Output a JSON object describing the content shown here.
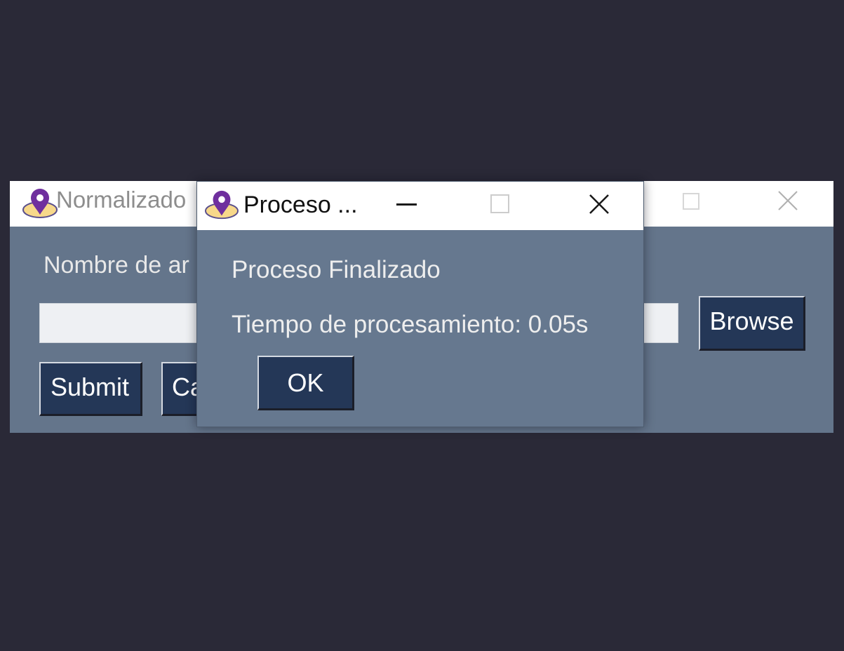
{
  "main_window": {
    "title": "Normalizado",
    "field_label": "Nombre de ar",
    "input_value": "",
    "browse_label": "Browse",
    "submit_label": "Submit",
    "cancel_label": "Ca"
  },
  "dialog": {
    "title": "Proceso ...",
    "message": "Proceso Finalizado",
    "time_text": "Tiempo de procesamiento: 0.05s",
    "ok_label": "OK"
  },
  "icons": {
    "app": "map-pin-icon",
    "minimize": "minimize-icon",
    "maximize": "maximize-icon",
    "close": "close-icon"
  },
  "colors": {
    "desktop": "#2a2937",
    "window_body": "#64758b",
    "button": "#243757",
    "pin": "#6f2f9e",
    "ellipse": "#f7d88a"
  }
}
